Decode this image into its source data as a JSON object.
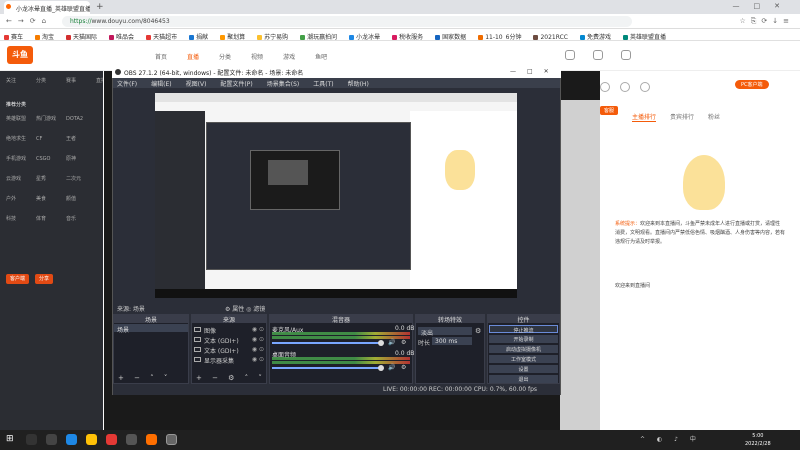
{
  "browser": {
    "tab_title": "小龙冰晕直播_英雄联盟直播",
    "url_host": "https://",
    "url_main": "www.douyu.com/8046453",
    "bookmarks": [
      "赛车",
      "淘宝",
      "天猫国际",
      "唯品会",
      "天猫超市",
      "捐献",
      "聚划算",
      "苏宁易购",
      "潮玩赢拍问",
      "小龙冰晕",
      "税收服务",
      "国家数据",
      "11-10_6分钟",
      "2021RCC",
      "免费游戏",
      "英雄联盟直播"
    ]
  },
  "douyu": {
    "logo": "斗鱼",
    "nav": [
      "首页",
      "直播",
      "分类",
      "视频",
      "游戏",
      "鱼吧"
    ],
    "sidebar_rows": [
      [
        "关注",
        "分类",
        "赛事",
        "直播"
      ],
      [
        "英雄联盟",
        "热门游戏",
        "DOTA2"
      ],
      [
        "绝地求生",
        "CF",
        "王者"
      ],
      [
        "手机游戏",
        "CSGO",
        "原神"
      ],
      [
        "云游戏",
        "星秀",
        "二次元"
      ],
      [
        "户外",
        "美食",
        "颜值"
      ],
      [
        "科技",
        "体育",
        "音乐"
      ]
    ],
    "sidebar_head": "推荐分类",
    "sidebar_btns": [
      "客户端",
      "分享"
    ],
    "pc_btn": "PC客户端",
    "kefu": "客服",
    "right_tabs": [
      "主播排行",
      "贵宾排行",
      "粉丝"
    ],
    "chat_name": "系统提示：",
    "chat_text": "欢迎来到本直播间，斗鱼严禁未成年人进行直播或打赏，请理性消费，文明观看。直播间内严禁低俗色情、吸烟酗酒、人身伤害等内容，若有违规行为请及时举报。",
    "chat_line2": "欢迎来到直播间"
  },
  "obs": {
    "title": "OBS 27.1.2 (64-bit, windows) - 配置文件: 未命名 - 场景: 未命名",
    "menu": [
      "文件(F)",
      "编辑(E)",
      "视图(V)",
      "配置文件(P)",
      "场景集合(S)",
      "工具(T)",
      "帮助(H)"
    ],
    "docks_bar_left": "来源: 场景",
    "docks_bar_props": "⚙ 属性",
    "docks_bar_filters": "◎ 滤镜",
    "scenes_header": "场景",
    "scene_item": "场景",
    "sources_header": "来源",
    "sources": [
      "图像",
      "文本 (GDI+)",
      "文本 (GDI+)",
      "显示器采集"
    ],
    "mixer_header": "混音器",
    "mixer": [
      {
        "name": "麦克风/Aux",
        "db": "0.0 dB"
      },
      {
        "name": "桌面音频",
        "db": "0.0 dB"
      }
    ],
    "trans_header": "转场特效",
    "trans_value": "淡出",
    "trans_dur_label": "时长",
    "trans_dur": "300 ms",
    "controls_header": "控件",
    "controls": [
      "停止推流",
      "开始录制",
      "启动虚拟摄像机",
      "工作室模式",
      "设置",
      "退出"
    ],
    "status": "LIVE: 00:00:00   REC: 00:00:00   CPU: 0.7%, 60.00 fps"
  },
  "taskbar": {
    "time": "5:00",
    "date": "2022/2/28"
  }
}
